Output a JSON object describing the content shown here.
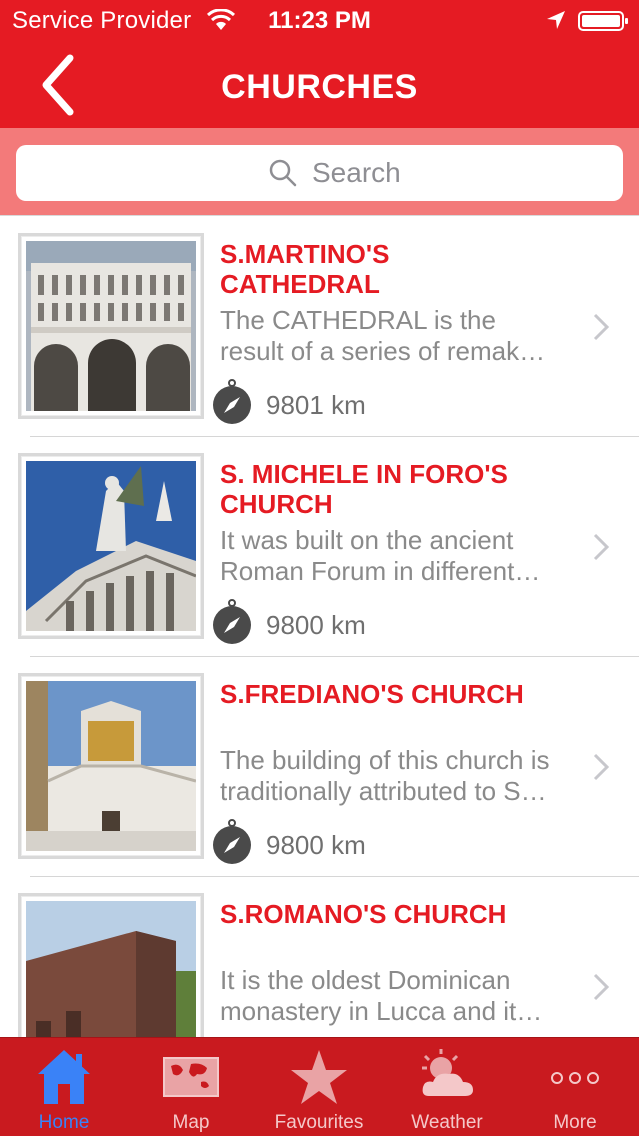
{
  "status_bar": {
    "carrier": "Service Provider",
    "time": "11:23 PM"
  },
  "nav": {
    "title": "CHURCHES",
    "back_icon": "chevron-left-icon"
  },
  "search": {
    "placeholder": "Search"
  },
  "churches": [
    {
      "name_line1": "S.MARTINO'S",
      "name_line2": "CATHEDRAL",
      "desc_line1": "The CATHEDRAL is the",
      "desc_line2": "result of a series of remak…",
      "distance": "9801 km"
    },
    {
      "name_line1": "S. MICHELE IN FORO'S",
      "name_line2": "CHURCH",
      "desc_line1": "It was built on the ancient",
      "desc_line2": "Roman Forum in different…",
      "distance": "9800 km"
    },
    {
      "name_line1": "S.FREDIANO'S CHURCH",
      "name_line2": "",
      "desc_line1": "The building of this church is",
      "desc_line2": "traditionally attributed to S…",
      "distance": "9800 km"
    },
    {
      "name_line1": "S.ROMANO'S CHURCH",
      "name_line2": "",
      "desc_line1": "It is the oldest Dominican",
      "desc_line2": "monastery in Lucca and it…",
      "distance": ""
    }
  ],
  "tabs": [
    {
      "label": "Home",
      "icon": "home-icon",
      "active": true
    },
    {
      "label": "Map",
      "icon": "world-map-icon",
      "active": false
    },
    {
      "label": "Favourites",
      "icon": "star-icon",
      "active": false
    },
    {
      "label": "Weather",
      "icon": "weather-icon",
      "active": false
    },
    {
      "label": "More",
      "icon": "more-dots-icon",
      "active": false
    }
  ],
  "colors": {
    "primary_red": "#e51b23",
    "search_band": "#f37a7a",
    "tabbar": "#c91a1f",
    "active_tab": "#3a82f7"
  }
}
